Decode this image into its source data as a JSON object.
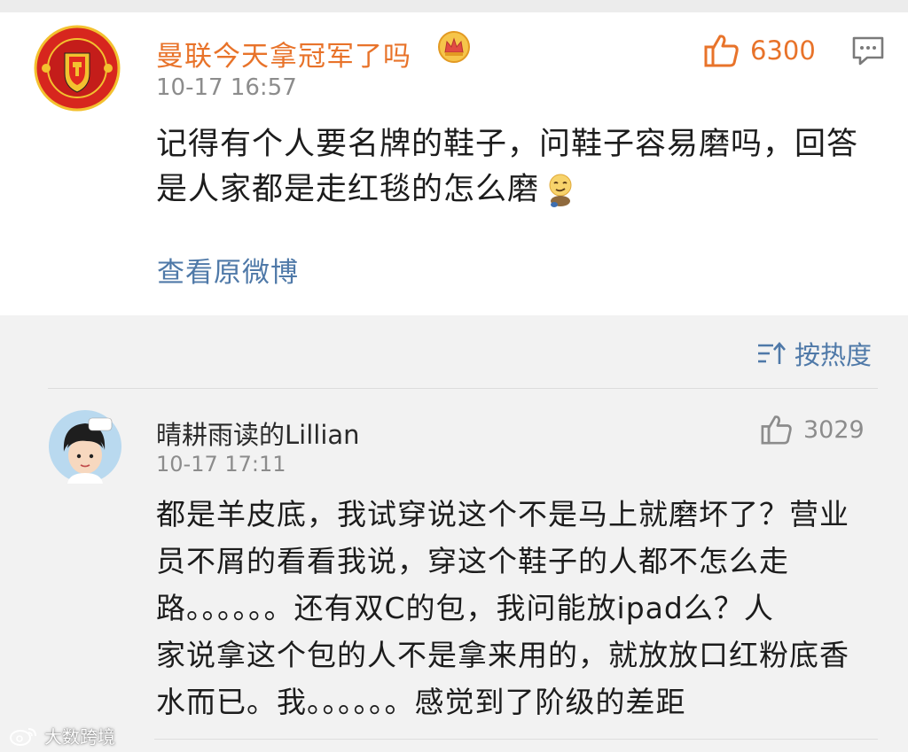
{
  "post": {
    "username": "曼联今天拿冠军了吗",
    "timestamp": "10-17 16:57",
    "like_count": "6300",
    "body_lines": [
      "记得有个人要名牌的鞋子，问鞋子容易磨吗，回答",
      "是人家都是走红毯的怎么磨"
    ],
    "view_original": "查看原微博"
  },
  "sort": {
    "label": "按热度"
  },
  "comment": {
    "username": "晴耕雨读的Lillian",
    "timestamp": "10-17 17:11",
    "like_count": "3029",
    "body_lines": [
      "都是羊皮底，我试穿说这个不是马上就磨坏了？营业",
      "员不屑的看看我说，穿这个鞋子的人都不怎么走",
      "路。。。。。。还有双C的包，我问能放ipad么？人",
      "家说拿这个包的人不是拿来用的，就放放口红粉底香",
      "水而已。我。。。。。。感觉到了阶级的差距"
    ]
  },
  "watermark": {
    "text": "大数跨境"
  },
  "colors": {
    "accent_orange": "#e8732a",
    "link_blue": "#4f79a8",
    "timestamp_gray": "#8c8c8c"
  },
  "icons": [
    "manchester-united-crest",
    "crown-badge-icon",
    "thumbs-up-icon",
    "comment-icon",
    "smirk-emoji",
    "sort-icon",
    "weibo-logo-icon"
  ]
}
